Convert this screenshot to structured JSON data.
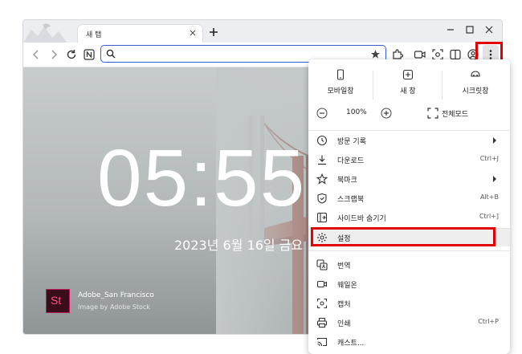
{
  "browser": {
    "tab": {
      "title": "새 탭"
    },
    "address_bar": {
      "value": ""
    },
    "accent_color": "#3b5bd6"
  },
  "newtab_page": {
    "clock": "05:55",
    "date": "2023년 6월 16일 금요",
    "photo_title": "Adobe_San Francisco",
    "photo_credit": "Image by Adobe Stock",
    "stock_logo": "St"
  },
  "menu": {
    "top_buttons": [
      {
        "label": "모바일창",
        "icon": "mobile-window-icon"
      },
      {
        "label": "새 창",
        "icon": "new-window-icon"
      },
      {
        "label": "시크릿창",
        "icon": "incognito-icon"
      }
    ],
    "zoom": {
      "value": "100%",
      "fullscreen_label": "전체모드"
    },
    "items": [
      {
        "label": "방문 기록",
        "shortcut": "",
        "submenu": true,
        "icon": "history-icon"
      },
      {
        "label": "다운로드",
        "shortcut": "Ctrl+J",
        "submenu": false,
        "icon": "download-icon"
      },
      {
        "label": "북마크",
        "shortcut": "",
        "submenu": true,
        "icon": "star-icon"
      },
      {
        "label": "스크랩북",
        "shortcut": "Alt+B",
        "submenu": false,
        "icon": "scrapbook-icon"
      },
      {
        "label": "사이드바 숨기기",
        "shortcut": "Ctrl+]",
        "submenu": false,
        "icon": "sidebar-icon"
      },
      {
        "label": "설정",
        "shortcut": "",
        "submenu": false,
        "icon": "gear-icon"
      },
      {
        "label": "번역",
        "shortcut": "",
        "submenu": false,
        "icon": "translate-icon"
      },
      {
        "label": "웨일온",
        "shortcut": "",
        "submenu": false,
        "icon": "whale-on-icon"
      },
      {
        "label": "캡처",
        "shortcut": "",
        "submenu": false,
        "icon": "capture-icon"
      },
      {
        "label": "인쇄",
        "shortcut": "Ctrl+P",
        "submenu": false,
        "icon": "print-icon"
      },
      {
        "label": "캐스트...",
        "shortcut": "",
        "submenu": false,
        "icon": "cast-icon"
      }
    ]
  },
  "highlight_color": "#e30000"
}
